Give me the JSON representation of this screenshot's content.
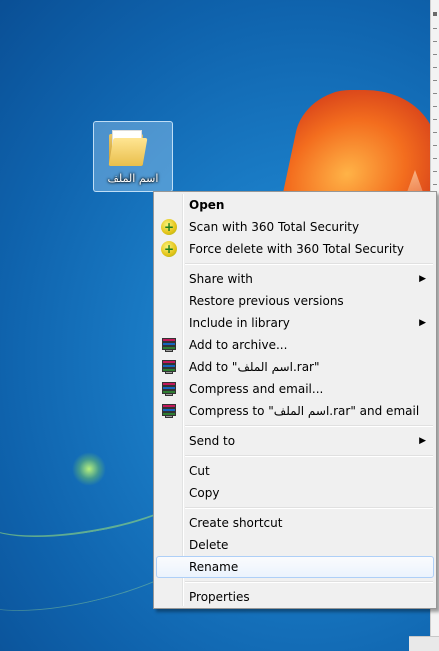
{
  "desktop": {
    "folder_label": "اسم الملف"
  },
  "menu": {
    "items": [
      {
        "label": "Open",
        "icon": "none",
        "submenu": false,
        "bold": true
      },
      {
        "label": "Scan with 360 Total Security",
        "icon": "360-security-icon",
        "submenu": false
      },
      {
        "label": "Force delete with 360 Total Security",
        "icon": "360-security-icon",
        "submenu": false
      },
      {
        "label": "Share with",
        "icon": "none",
        "submenu": true
      },
      {
        "label": "Restore previous versions",
        "icon": "none",
        "submenu": false
      },
      {
        "label": "Include in library",
        "icon": "none",
        "submenu": true
      },
      {
        "label": "Add to archive...",
        "icon": "winrar-icon",
        "submenu": false
      },
      {
        "label": "Add to \"اسم الملف.rar\"",
        "icon": "winrar-icon",
        "submenu": false
      },
      {
        "label": "Compress and email...",
        "icon": "winrar-icon",
        "submenu": false
      },
      {
        "label": "Compress to \"اسم الملف.rar\" and email",
        "icon": "winrar-icon",
        "submenu": false
      },
      {
        "label": "Send to",
        "icon": "none",
        "submenu": true
      },
      {
        "label": "Cut",
        "icon": "none",
        "submenu": false
      },
      {
        "label": "Copy",
        "icon": "none",
        "submenu": false
      },
      {
        "label": "Create shortcut",
        "icon": "none",
        "submenu": false
      },
      {
        "label": "Delete",
        "icon": "none",
        "submenu": false
      },
      {
        "label": "Rename",
        "icon": "none",
        "submenu": false,
        "highlighted": true
      },
      {
        "label": "Properties",
        "icon": "none",
        "submenu": false
      }
    ],
    "submenu_arrow": "▶"
  },
  "colors": {
    "menu_background": "#f0f0f0",
    "highlight_border": "#aecff7",
    "desktop_blue": "#1a7cc6"
  }
}
